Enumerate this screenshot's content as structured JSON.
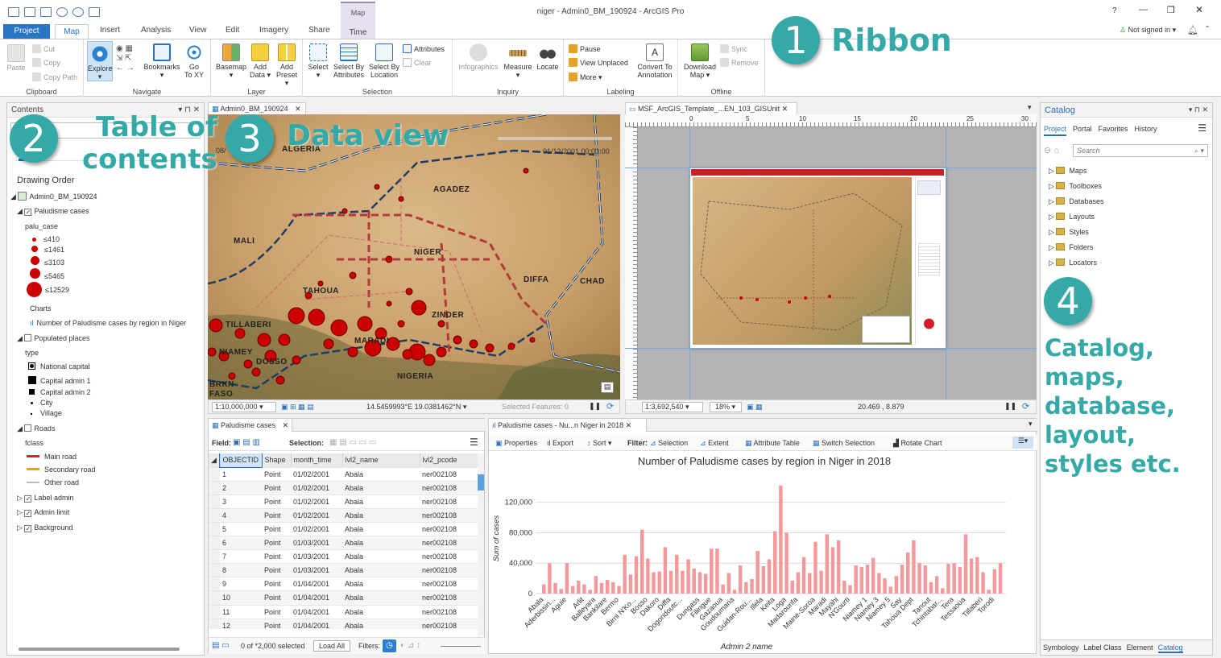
{
  "titlebar": {
    "title": "niger - Admin0_BM_190924 - ArcGIS Pro",
    "help": "?",
    "signin": "Not signed in"
  },
  "ribbon": {
    "tabs": [
      {
        "label": "Project"
      },
      {
        "label": "Map"
      },
      {
        "label": "Insert"
      },
      {
        "label": "Analysis"
      },
      {
        "label": "View"
      },
      {
        "label": "Edit"
      },
      {
        "label": "Imagery"
      },
      {
        "label": "Share"
      },
      {
        "label": "Time"
      }
    ],
    "context_tab": "Map",
    "clipboard": {
      "paste": "Paste",
      "cut": "Cut",
      "copy": "Copy",
      "copy_path": "Copy Path",
      "label": "Clipboard"
    },
    "navigate": {
      "explore": "Explore",
      "bookmarks": "Bookmarks",
      "goto": "Go To XY",
      "goto1": "Go",
      "goto2": "To XY",
      "label": "Navigate"
    },
    "layer": {
      "basemap": "Basemap",
      "add_data1": "Add",
      "add_data2": "Data",
      "add_preset1": "Add",
      "add_preset2": "Preset",
      "label": "Layer"
    },
    "selection": {
      "select": "Select",
      "by_attr1": "Select By",
      "by_attr2": "Attributes",
      "by_loc1": "Select By",
      "by_loc2": "Location",
      "attributes": "Attributes",
      "clear": "Clear",
      "label": "Selection"
    },
    "inquiry": {
      "infographics": "Infographics",
      "measure": "Measure",
      "locate": "Locate",
      "label": "Inquiry"
    },
    "labeling": {
      "pause": "Pause",
      "view_unplaced": "View Unplaced",
      "more": "More",
      "convert1": "Convert To",
      "convert2": "Annotation",
      "label": "Labeling"
    },
    "offline": {
      "download1": "Download",
      "download2": "Map",
      "sync": "Sync",
      "remove": "Remove",
      "label": "Offline"
    }
  },
  "toc": {
    "title": "Contents",
    "drawing_order": "Drawing Order",
    "map": "Admin0_BM_190924",
    "layer_palu": "Paludisme cases",
    "field": "palu_case",
    "classes": [
      "≤410",
      "≤1461",
      "≤3103",
      "≤5465",
      "≤12529"
    ],
    "charts_label": "Charts",
    "chart_item": "Number of Paludisme cases by region in Niger",
    "populated": "Populated places",
    "type_label": "type",
    "types": [
      "National capital",
      "Capital admin 1",
      "Capital admin 2",
      "City",
      "Village"
    ],
    "roads": "Roads",
    "fclass": "fclass",
    "road_types": [
      "Main road",
      "Secondary road",
      "Other road"
    ],
    "others": [
      "Label admin",
      "Admin limit",
      "Background"
    ]
  },
  "map": {
    "tab": "Admin0_BM_190924",
    "time_start": "08/",
    "time_end": "01/12/2001 00:00:00",
    "labels": [
      "ALGERIA",
      "AGADEZ",
      "MALI",
      "NIGER",
      "DIFFA",
      "CHAD",
      "TAHOUA",
      "ZINDER",
      "TILLABERI",
      "NIAMEY",
      "DOSSO",
      "MARADI",
      "NIGERIA",
      "BRKN",
      "FASO"
    ],
    "scale": "1:10,000,000",
    "coords": "14.5459993°E 19.0381462°N",
    "selected": "Selected Features: 0"
  },
  "layoutview": {
    "tab": "MSF_ArcGIS_Template_...EN_103_GISUnit",
    "ruler": [
      "0",
      "5",
      "10",
      "15",
      "20",
      "25",
      "30"
    ],
    "scale": "1:3,692,540",
    "zoom": "18%",
    "coords": "20.469 , 8.879"
  },
  "attr": {
    "tab": "Paludisme cases",
    "field": "Field:",
    "selection": "Selection:",
    "columns": [
      "OBJECTID",
      "Shape",
      "month_time",
      "lvl2_name",
      "lvl2_pcode"
    ],
    "rows": [
      [
        "1",
        "Point",
        "01/02/2001",
        "Abala",
        "ner002108"
      ],
      [
        "2",
        "Point",
        "01/02/2001",
        "Abala",
        "ner002108"
      ],
      [
        "3",
        "Point",
        "01/02/2001",
        "Abala",
        "ner002108"
      ],
      [
        "4",
        "Point",
        "01/02/2001",
        "Abala",
        "ner002108"
      ],
      [
        "5",
        "Point",
        "01/02/2001",
        "Abala",
        "ner002108"
      ],
      [
        "6",
        "Point",
        "01/03/2001",
        "Abala",
        "ner002108"
      ],
      [
        "7",
        "Point",
        "01/03/2001",
        "Abala",
        "ner002108"
      ],
      [
        "8",
        "Point",
        "01/03/2001",
        "Abala",
        "ner002108"
      ],
      [
        "9",
        "Point",
        "01/04/2001",
        "Abala",
        "ner002108"
      ],
      [
        "10",
        "Point",
        "01/04/2001",
        "Abala",
        "ner002108"
      ],
      [
        "11",
        "Point",
        "01/04/2001",
        "Abala",
        "ner002108"
      ],
      [
        "12",
        "Point",
        "01/04/2001",
        "Abala",
        "ner002108"
      ]
    ],
    "status": "0 of *2,000 selected",
    "load_all": "Load All",
    "filters": "Filters:"
  },
  "chartpane": {
    "tab": "Paludisme cases - Nu...n Niger in 2018",
    "toolbar": {
      "properties": "Properties",
      "export": "Export",
      "sort": "Sort",
      "filter": "Filter:",
      "selection": "Selection",
      "extent": "Extent",
      "attr_table": "Attribute Table",
      "switch_sel": "Switch Selection",
      "rotate": "Rotate Chart"
    }
  },
  "chart_data": {
    "type": "bar",
    "title": "Number of Paludisme cases by region in Niger in 2018",
    "xlabel": "Admin 2 name",
    "ylabel": "Sum of cases",
    "ylim": [
      0,
      145000
    ],
    "yticks": [
      "0",
      "40,000",
      "80,000",
      "120,000"
    ],
    "ytick_values": [
      0,
      40000,
      80000,
      120000
    ],
    "shown_labels": [
      "Abala",
      "Aderbissin...",
      "Aguie",
      "Arlit",
      "Balleyara",
      "Bankilare",
      "Bermo",
      "Birni N'Ko...",
      "Bosso",
      "Dakoro",
      "Diffa",
      "Dogondoutc...",
      "Dungass",
      "Filingue",
      "Gazaoua",
      "Goudoumaria",
      "Guidan-Rou...",
      "Illela",
      "Keita",
      "Loga",
      "Madarounfa",
      "Maine-Soroa",
      "Maradi",
      "Mayahi",
      "N'Gourti",
      "Niamey 1",
      "Niamey 3",
      "Niamey 5",
      "Say",
      "Tahoua Dept",
      "Tanout",
      "Tchintabar...",
      "Tera",
      "Tessaoua",
      "Tillaberi",
      "Torodi"
    ],
    "values": [
      12000,
      40000,
      14000,
      6000,
      40000,
      10000,
      17000,
      12000,
      5000,
      23000,
      14000,
      18000,
      15000,
      10000,
      51000,
      25000,
      49000,
      84000,
      46000,
      28000,
      29000,
      61000,
      30000,
      51000,
      30000,
      45000,
      33000,
      28000,
      26000,
      59000,
      59000,
      12000,
      27000,
      5000,
      37000,
      15000,
      19000,
      56000,
      36000,
      45000,
      82000,
      142000,
      80000,
      17000,
      28000,
      48000,
      27000,
      68000,
      30000,
      78000,
      61000,
      70000,
      17000,
      11000,
      37000,
      35000,
      38000,
      47000,
      27000,
      20000,
      9000,
      23000,
      38000,
      54000,
      70000,
      40000,
      37000,
      15000,
      23000,
      7000,
      39000,
      40000,
      35000,
      78000,
      46000,
      48000,
      28000,
      5000,
      32000,
      40000
    ],
    "color": "#f3999c",
    "grid": true
  },
  "catalog": {
    "title": "Catalog",
    "tabs": [
      "Project",
      "Portal",
      "Favorites",
      "History"
    ],
    "search": "Search",
    "items": [
      "Maps",
      "Toolboxes",
      "Databases",
      "Layouts",
      "Styles",
      "Folders",
      "Locators"
    ],
    "bottom_tabs": [
      "Symbology",
      "Label Class",
      "Element",
      "Catalog"
    ]
  },
  "annotations": {
    "n1": "1",
    "t1": "Ribbon",
    "n2": "2",
    "t2a": "Table of",
    "t2b": "contents",
    "n3": "3",
    "t3": "Data view",
    "n4": "4",
    "t4": [
      "Catalog,",
      "maps,",
      "database,",
      "layout,",
      "styles etc."
    ],
    "color": "#35a9a7"
  }
}
